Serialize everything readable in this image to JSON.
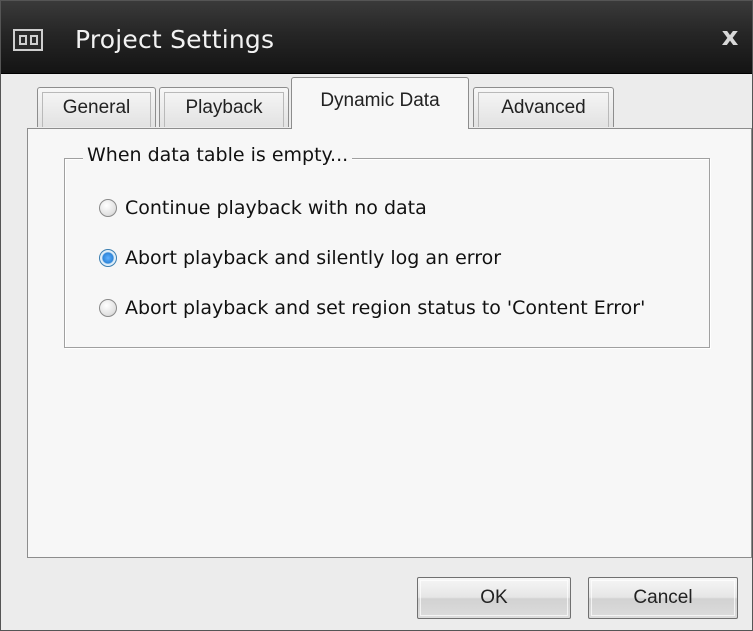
{
  "window": {
    "title": "Project Settings",
    "close_glyph": "x",
    "app_icon": "dialog-app-icon"
  },
  "tabs": [
    {
      "label": "General",
      "active": false
    },
    {
      "label": "Playback",
      "active": false
    },
    {
      "label": "Dynamic Data",
      "active": true
    },
    {
      "label": "Advanced",
      "active": false
    }
  ],
  "group": {
    "legend": "When data table is empty..."
  },
  "options": [
    {
      "label": "Continue playback with no data",
      "checked": false
    },
    {
      "label": "Abort playback and silently log an error",
      "checked": true
    },
    {
      "label": "Abort playback and set region status to 'Content Error'",
      "checked": false
    }
  ],
  "buttons": {
    "ok": "OK",
    "cancel": "Cancel"
  },
  "colors": {
    "titlebar": "#262626",
    "radio_selected": "#2f86d9"
  }
}
